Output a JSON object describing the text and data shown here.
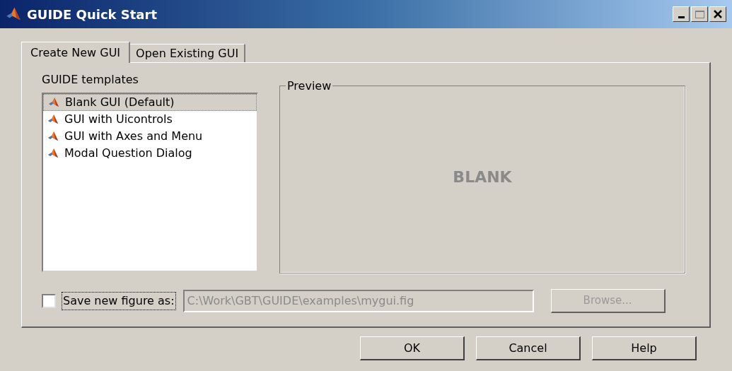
{
  "window": {
    "title": "GUIDE Quick Start"
  },
  "tabs": [
    {
      "label": "Create New GUI",
      "selected": true
    },
    {
      "label": "Open Existing GUI",
      "selected": false
    }
  ],
  "templates": {
    "label": "GUIDE templates",
    "items": [
      {
        "label": "Blank GUI (Default)",
        "selected": true
      },
      {
        "label": "GUI with Uicontrols",
        "selected": false
      },
      {
        "label": "GUI with Axes and Menu",
        "selected": false
      },
      {
        "label": "Modal Question Dialog",
        "selected": false
      }
    ]
  },
  "preview": {
    "label": "Preview",
    "text": "BLANK"
  },
  "save": {
    "label": "Save new figure as:",
    "checked": false,
    "path": "C:\\Work\\GBT\\GUIDE\\examples\\mygui.fig",
    "disabled": true,
    "browse": "Browse..."
  },
  "buttons": [
    "OK",
    "Cancel",
    "Help"
  ]
}
